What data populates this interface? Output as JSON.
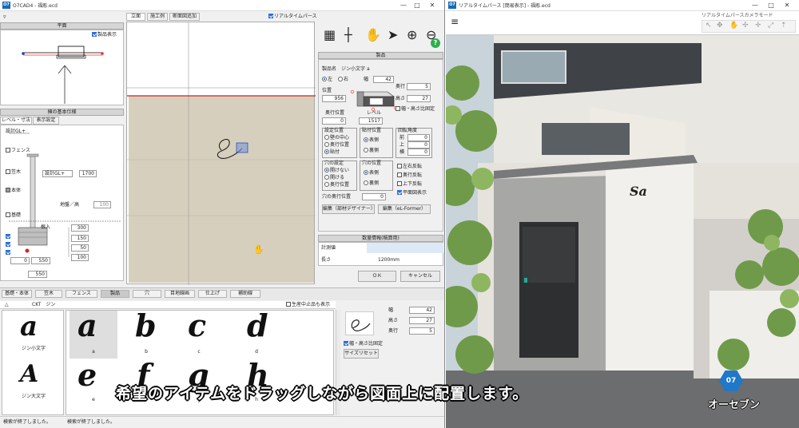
{
  "left_window": {
    "title": "O7CAD4 - 福彫.ecd",
    "logo": "O7",
    "controls": [
      "—",
      "□",
      "✕"
    ],
    "plan_panel": {
      "title": "平面",
      "display_checkbox": "製品表示",
      "checked": true
    },
    "spec_panel": {
      "title": "擁の基本仕様",
      "tabs": [
        "レベル・寸法",
        "表示設定"
      ],
      "base": "設計GL+",
      "options": [
        {
          "label": "フェンス",
          "checked": false
        },
        {
          "label": "笠木",
          "checked": false
        },
        {
          "label": "本体",
          "checked": false
        },
        {
          "label": "基礎",
          "checked": false
        }
      ],
      "gl_select": "設計GL+",
      "height_value": "1700",
      "ground_label": "地盤／高",
      "ground_value": "100",
      "root_label": "根入",
      "dims": [
        "300",
        "150",
        "50",
        "100"
      ],
      "bottom_dims": [
        "0",
        "550"
      ],
      "bottom_total": "550"
    },
    "view_tabs": [
      "立面",
      "施工例",
      "断面図追加"
    ],
    "realtime_check": "リアルタイムパース",
    "realtime_checked": true,
    "product_panel": {
      "title": "製品",
      "name_label": "製品名",
      "name_value": "ジン小文字 a",
      "side_left": "左",
      "side_right": "右",
      "width_label": "幅",
      "width_value": "42",
      "depth_label": "奥行",
      "depth_value": "5",
      "height_label": "高さ",
      "height_value": "27",
      "pos_label": "位置",
      "pos_value": "956",
      "depth_pos_label": "奥行位置",
      "depth_pos_value": "0",
      "level_label": "レベル",
      "level_value": "1517",
      "ratio_label": "幅・高さ比固定",
      "set_pos_title": "設定位置",
      "set_pos_options": [
        "壁の中心",
        "奥行位置",
        "貼付"
      ],
      "set_pos_selected": 2,
      "attach_title": "貼付位置",
      "attach_options": [
        "表側",
        "裏側"
      ],
      "attach_selected": 0,
      "rotate_title": "回転角度",
      "rotate_labels": [
        "前",
        "上",
        "横"
      ],
      "rotate_values": [
        "0",
        "0",
        "0"
      ],
      "hole_title": "穴の設定",
      "hole_options": [
        "開けない",
        "開ける",
        "奥行位置"
      ],
      "hole_selected": 0,
      "hole_pos_title": "穴の位置",
      "hole_pos_options": [
        "表側",
        "裏側"
      ],
      "hole_pos_selected": 0,
      "flip_options": [
        "左右反転",
        "奥行反転",
        "上下反転",
        "平面図表示"
      ],
      "flip_checked": [
        false,
        false,
        false,
        true
      ],
      "hole_depth_label": "穴の奥行位置",
      "hole_depth_value": "0",
      "edit_buttons": [
        "編集（部材デザイナー）",
        "編集（eL-Former）"
      ]
    },
    "quantity_panel": {
      "title": "数量情報(積算用)",
      "col_header": "計測値",
      "row_label": "長さ",
      "row_value": "1200mm"
    },
    "ok_label": "ＯＫ",
    "cancel_label": "キャンセル",
    "bottom_tabs": [
      "基礎・本体",
      "笠木",
      "フェンス",
      "製品",
      "穴",
      "目地線画",
      "仕上げ",
      "補助線"
    ],
    "bottom_tab_active": 3,
    "library_path": "CKT　ジン",
    "production_check": "生産中止品も表示",
    "thumbnails": [
      {
        "char": "a",
        "label": "ジン小文字"
      },
      {
        "char": "A",
        "label": "ジン大文字"
      }
    ],
    "glyphs": [
      {
        "char": "a",
        "label": "a"
      },
      {
        "char": "b",
        "label": "b"
      },
      {
        "char": "c",
        "label": "c"
      },
      {
        "char": "d",
        "label": "d"
      },
      {
        "char": "e",
        "label": "e"
      },
      {
        "char": "f",
        "label": "f"
      },
      {
        "char": "g",
        "label": "g"
      },
      {
        "char": "h",
        "label": "h"
      }
    ],
    "right_info": {
      "width_label": "幅",
      "width_value": "42",
      "height_label": "高さ",
      "height_value": "27",
      "depth_label": "奥行",
      "depth_value": "5",
      "ratio_label": "幅・高さ比固定",
      "reset_label": "サイズリセット"
    },
    "status": [
      "検索が終了しました。",
      "検索が終了しました。"
    ]
  },
  "right_window": {
    "title": "リアルタイムパース [簡易表示] - 福彫.ecd",
    "logo": "O7",
    "controls": [
      "—",
      "□",
      "✕"
    ],
    "camera_mode": "リアルタイムパースカメラモード",
    "wall_sign": "Sa",
    "brand": "オーセブン",
    "brand_badge": "07"
  },
  "caption": "希望のアイテムをドラッグしながら図面上に配置します。",
  "colors": {
    "accent": "#1a55c0",
    "wall": "#d7cfbd",
    "panel": "#d6d6d6"
  }
}
